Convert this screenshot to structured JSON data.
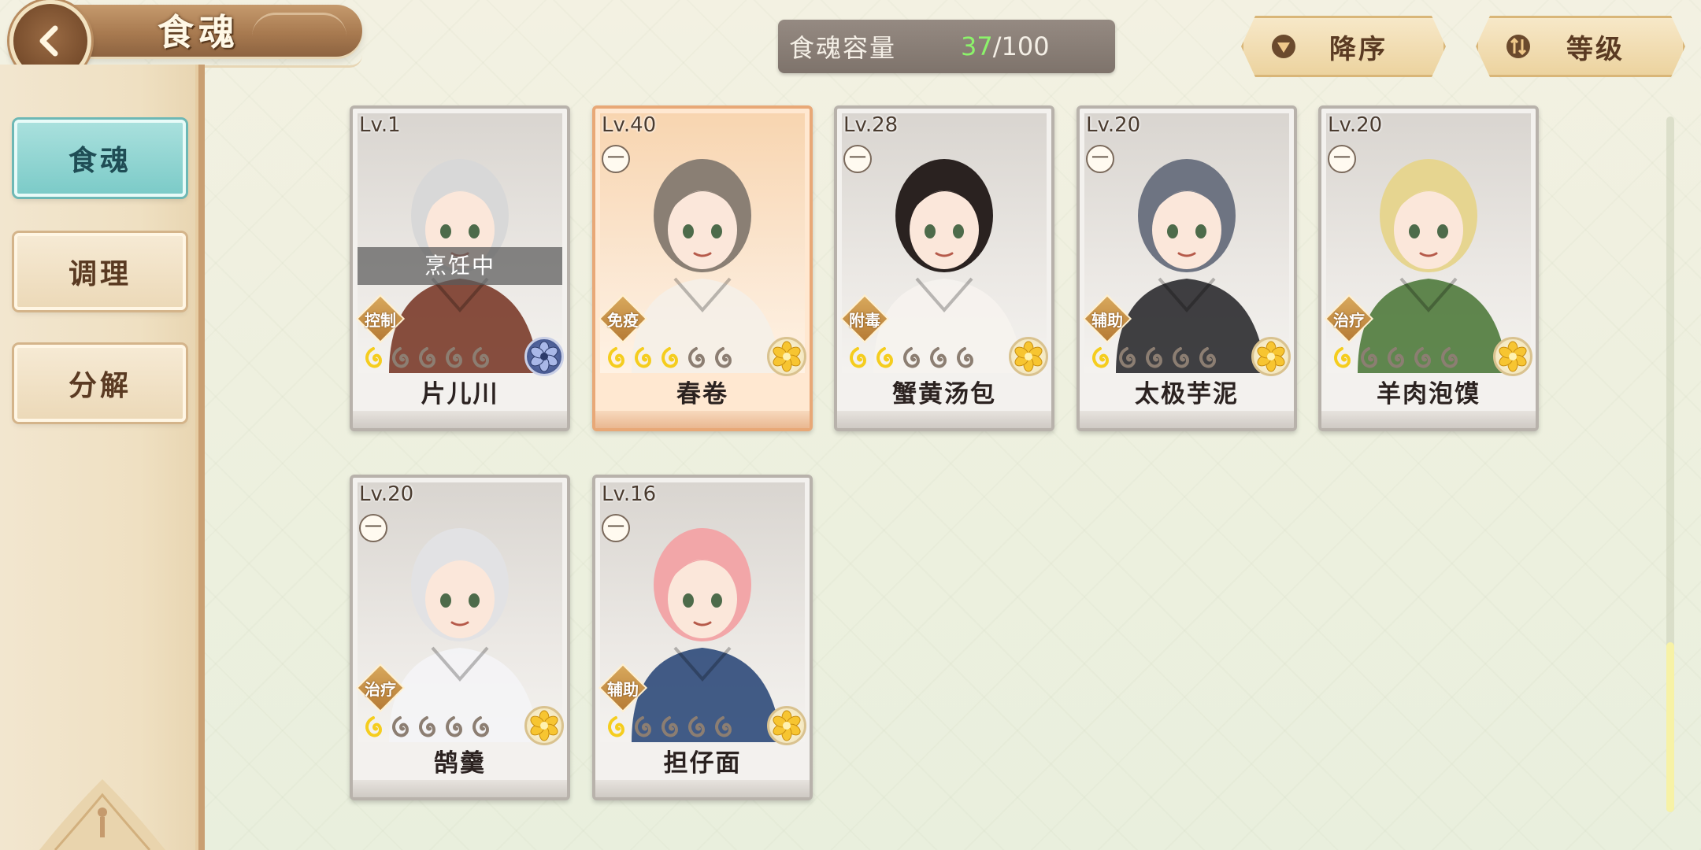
{
  "header": {
    "title": "食魂",
    "back_icon": "back-arrow-icon"
  },
  "sidebar": {
    "items": [
      {
        "label": "食魂",
        "active": true
      },
      {
        "label": "调理",
        "active": false
      },
      {
        "label": "分解",
        "active": false
      }
    ]
  },
  "capacity": {
    "label": "食魂容量",
    "current": "37",
    "separator": "/",
    "max": "100"
  },
  "sort": {
    "order_label": "降序",
    "order_icon": "triangle-down-icon",
    "field_label": "等级",
    "field_icon": "sort-arrows-icon"
  },
  "cards": [
    {
      "level": "Lv.1",
      "grade": "",
      "status": "烹饪中",
      "role": "控制",
      "stars": 1,
      "max_stars": 5,
      "element": "blue-flower-icon",
      "name": "片儿川",
      "frame": "gray",
      "hair": "#d8d8d8",
      "outfit": "#7a3b2a"
    },
    {
      "level": "Lv.40",
      "grade": "一",
      "status": "",
      "role": "免疫",
      "stars": 3,
      "max_stars": 5,
      "element": "gold-flower-icon",
      "name": "春卷",
      "frame": "orange",
      "hair": "#8a7f74",
      "outfit": "#f5f0e8"
    },
    {
      "level": "Lv.28",
      "grade": "一",
      "status": "",
      "role": "附毒",
      "stars": 2,
      "max_stars": 5,
      "element": "gold-flower-icon",
      "name": "蟹黄汤包",
      "frame": "gray",
      "hair": "#2a2220",
      "outfit": "#f6f3ee"
    },
    {
      "level": "Lv.20",
      "grade": "一",
      "status": "",
      "role": "辅助",
      "stars": 1,
      "max_stars": 5,
      "element": "gold-flower-icon",
      "name": "太极芋泥",
      "frame": "gray",
      "hair": "#6e7482",
      "outfit": "#2b2b2f"
    },
    {
      "level": "Lv.20",
      "grade": "一",
      "status": "",
      "role": "治疗",
      "stars": 1,
      "max_stars": 5,
      "element": "gold-flower-icon",
      "name": "羊肉泡馍",
      "frame": "gray",
      "hair": "#e6d590",
      "outfit": "#4f7a3c"
    },
    {
      "level": "Lv.20",
      "grade": "一",
      "status": "",
      "role": "治疗",
      "stars": 1,
      "max_stars": 5,
      "element": "gold-flower-icon",
      "name": "鹄羹",
      "frame": "gray",
      "hair": "#e2e2e4",
      "outfit": "#f4f4f6"
    },
    {
      "level": "Lv.16",
      "grade": "一",
      "status": "",
      "role": "辅助",
      "stars": 1,
      "max_stars": 5,
      "element": "gold-flower-icon",
      "name": "担仔面",
      "frame": "gray",
      "hair": "#f2a6a8",
      "outfit": "#2d4a7a"
    }
  ],
  "colors": {
    "active_tab": "#7ccbc8",
    "capacity_current": "#8cf36b",
    "role_badge": "#c58c42",
    "star_filled": "#f5cd1e",
    "star_empty": "#8c7e72"
  },
  "scroll": {
    "position": 0.76
  }
}
